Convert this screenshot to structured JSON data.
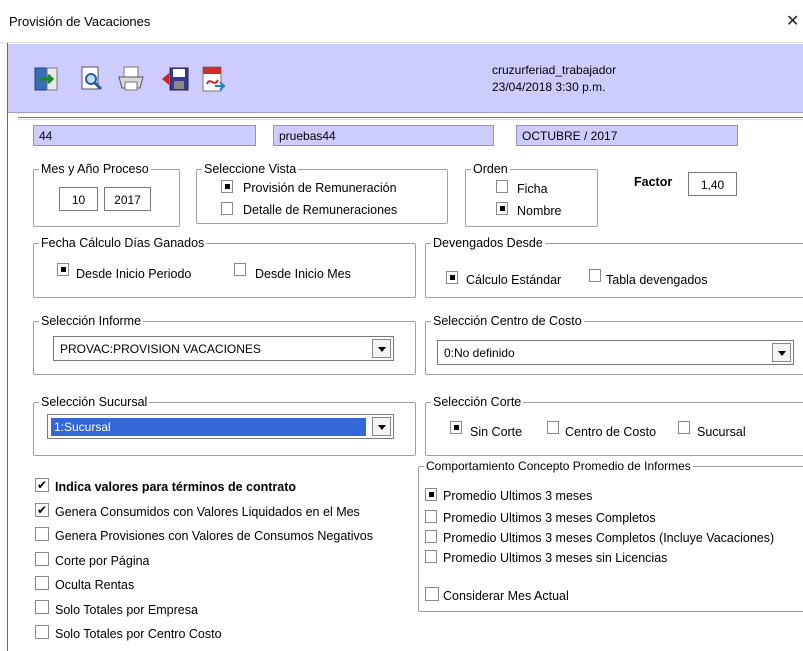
{
  "window": {
    "title": "Provisión de Vacaciones",
    "close": "✕"
  },
  "toolbar": {
    "icons": [
      "exit-icon",
      "preview-icon",
      "print-icon",
      "save-icon",
      "pdf-icon"
    ],
    "user": "cruzurferiad_trabajador",
    "datetime": "23/04/2018 3:30 p.m."
  },
  "header": {
    "code": "44",
    "company": "pruebas44",
    "period": "OCTUBRE / 2017"
  },
  "mes_anio": {
    "legend": "Mes y Año Proceso",
    "mes": "10",
    "anio": "2017"
  },
  "vista": {
    "legend": "Seleccione Vista",
    "options": [
      "Provisión de Remuneración",
      "Detalle de Remuneraciones"
    ],
    "selected": 0
  },
  "orden": {
    "legend": "Orden",
    "options": [
      "Ficha",
      "Nombre"
    ],
    "selected": 1
  },
  "factor": {
    "label": "Factor",
    "value": "1,40"
  },
  "fecha_calculo": {
    "legend": "Fecha Cálculo Días Ganados",
    "options": [
      "Desde Inicio Periodo",
      "Desde Inicio Mes"
    ],
    "selected": 0
  },
  "devengados": {
    "legend": "Devengados Desde",
    "options": [
      "Cálculo Estándar",
      "Tabla devengados"
    ],
    "selected": 0
  },
  "informe": {
    "legend": "Selección Informe",
    "value": "PROVAC:PROVISION VACACIONES"
  },
  "centro_costo": {
    "legend": "Selección Centro de Costo",
    "value": "0:No definido"
  },
  "sucursal": {
    "legend": "Selección Sucursal",
    "value": "1:Sucursal"
  },
  "corte": {
    "legend": "Selección Corte",
    "options": [
      "Sin Corte",
      "Centro de Costo",
      "Sucursal"
    ],
    "selected": 0
  },
  "checks": [
    {
      "label": "Indica valores para términos de contrato",
      "checked": true
    },
    {
      "label": "Genera Consumidos con Valores Liquidados en el Mes",
      "checked": true
    },
    {
      "label": "Genera Provisiones con Valores de Consumos Negativos",
      "checked": false
    },
    {
      "label": "Corte por Página",
      "checked": false
    },
    {
      "label": "Oculta Rentas",
      "checked": false
    },
    {
      "label": "Solo Totales por Empresa",
      "checked": false
    },
    {
      "label": "Solo Totales por Centro Costo",
      "checked": false
    }
  ],
  "promedio": {
    "legend": "Comportamiento Concepto Promedio de Informes",
    "options": [
      "Promedio Ultimos 3 meses",
      "Promedio Ultimos 3 meses Completos",
      "Promedio Ultimos 3 meses Completos (Incluye Vacaciones)",
      "Promedio Ultimos 3 meses sin Licencias"
    ],
    "selected": 0,
    "considerar": {
      "label": "Considerar Mes Actual",
      "checked": false
    }
  },
  "colors": {
    "toolbar_bg": "#ccccff",
    "info_bg": "#ccccff",
    "selection": "#3367d6"
  }
}
